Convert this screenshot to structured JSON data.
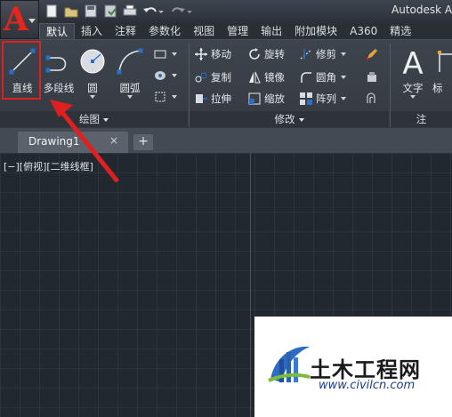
{
  "app": {
    "logo_letter": "A",
    "title": "Autodesk A"
  },
  "quick_access": {
    "icons": [
      "new-icon",
      "open-icon",
      "save-icon",
      "save-as-icon",
      "print-icon",
      "undo-icon",
      "redo-icon"
    ]
  },
  "ribbon_tabs": [
    {
      "label": "默认",
      "active": true
    },
    {
      "label": "插入"
    },
    {
      "label": "注释"
    },
    {
      "label": "参数化"
    },
    {
      "label": "视图"
    },
    {
      "label": "管理"
    },
    {
      "label": "输出"
    },
    {
      "label": "附加模块"
    },
    {
      "label": "A360"
    },
    {
      "label": "精选"
    }
  ],
  "draw_panel": {
    "title": "绘图",
    "line_label": "直线",
    "polyline_label": "多段线",
    "circle_label": "圆",
    "arc_label": "圆弧"
  },
  "modify_panel": {
    "title": "修改",
    "move": "移动",
    "rotate": "旋转",
    "trim": "修剪",
    "copy": "复制",
    "mirror": "镜像",
    "fillet": "圆角",
    "stretch": "拉伸",
    "scale": "缩放",
    "array": "阵列"
  },
  "annotation_panel": {
    "title": "注",
    "text_label": "文字",
    "dim_label": "标"
  },
  "document": {
    "tab_name": "Drawing1",
    "close_symbol": "×",
    "new_tab_symbol": "+"
  },
  "viewport": {
    "label": "[−][俯视][二维线框]"
  },
  "watermark": {
    "name": "土木工程网",
    "url": "www.civilcn.com"
  },
  "colors": {
    "accent_red": "#e02020",
    "canvas_bg": "#212830",
    "y_axis": "#2f6a2f",
    "ribbon_bg": "#3e444d"
  }
}
